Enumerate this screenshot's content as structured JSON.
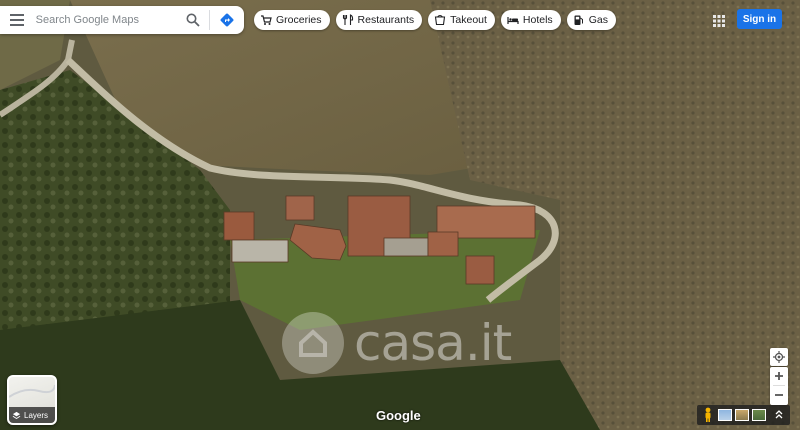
{
  "search": {
    "placeholder": "Search Google Maps"
  },
  "chips": [
    {
      "label": "Groceries",
      "icon": "cart-icon"
    },
    {
      "label": "Restaurants",
      "icon": "fork-knife-icon"
    },
    {
      "label": "Takeout",
      "icon": "takeout-icon"
    },
    {
      "label": "Hotels",
      "icon": "bed-icon"
    },
    {
      "label": "Gas",
      "icon": "gas-pump-icon"
    }
  ],
  "header": {
    "signin_label": "Sign in"
  },
  "watermark": {
    "text": "casa.it"
  },
  "layers": {
    "label": "Layers"
  },
  "attribution": {
    "logo_text": "Google"
  },
  "map_view": {
    "type": "satellite",
    "subject": "rural farmhouse cluster among fields and trees"
  },
  "colors": {
    "accent": "#1a73e8",
    "directions": "#1a73e8"
  }
}
